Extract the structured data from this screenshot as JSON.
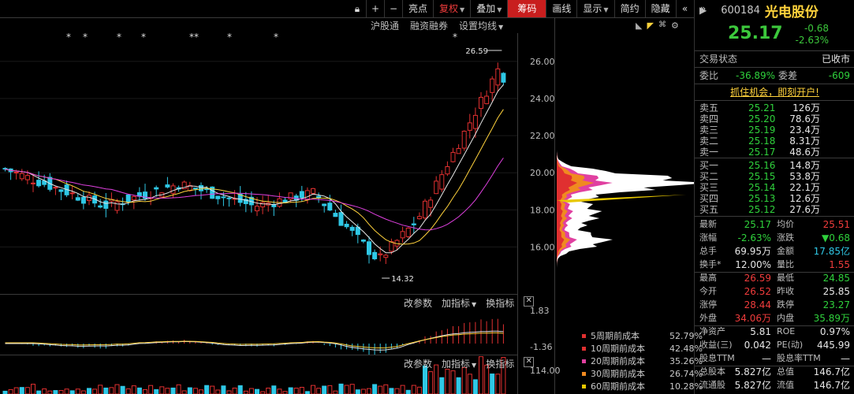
{
  "toolbar": {
    "icons": [
      "lock-icon",
      "plus-icon",
      "minus-icon"
    ],
    "buttons": [
      {
        "label": "亮点",
        "dropdown": false,
        "active": false
      },
      {
        "label": "复权",
        "dropdown": true,
        "active": false
      },
      {
        "label": "叠加",
        "dropdown": true,
        "active": false
      },
      {
        "label": "筹码",
        "dropdown": false,
        "active": true
      },
      {
        "label": "画线",
        "dropdown": false,
        "active": false
      },
      {
        "label": "显示",
        "dropdown": true,
        "active": false
      },
      {
        "label": "简约",
        "dropdown": false,
        "active": false
      },
      {
        "label": "隐藏",
        "dropdown": false,
        "active": false
      }
    ],
    "nav": [
      "«",
      "»"
    ]
  },
  "subbar": {
    "items": [
      "沪股通",
      "融资融券",
      "设置均线"
    ]
  },
  "chart": {
    "price_ticks": [
      "26.00",
      "24.00",
      "22.00",
      "20.00",
      "18.00",
      "16.00"
    ],
    "high_label": "26.59",
    "low_label": "14.32",
    "stars": [
      "*",
      "*",
      "*",
      "*",
      "*",
      "**",
      "*",
      "*",
      "*"
    ],
    "macd": {
      "top": "1.83",
      "bottom": "-1.36"
    },
    "volume": {
      "top": "114.00"
    },
    "indicator_bar": [
      "改参数",
      "加指标",
      "换指标"
    ]
  },
  "cost_legend": [
    {
      "name": "5周期前成本",
      "value": "52.79%",
      "color": "#e03030"
    },
    {
      "name": "10周期前成本",
      "value": "42.48%",
      "color": "#e03030"
    },
    {
      "name": "20周期前成本",
      "value": "35.26%",
      "color": "#e040a0"
    },
    {
      "name": "30周期前成本",
      "value": "26.74%",
      "color": "#f08a20"
    },
    {
      "name": "60周期前成本",
      "value": "10.28%",
      "color": "#e8c800"
    }
  ],
  "quote": {
    "code": "600184",
    "name": "光电股份",
    "price": "25.17",
    "change": "-0.68",
    "change_pct": "-2.63%",
    "status_label": "交易状态",
    "status": "已收市",
    "weibi_label": "委比",
    "weibi": "-36.89%",
    "weicha_label": "委差",
    "weicha": "-609",
    "promo": "抓住机会，即刻开户!",
    "asks": [
      {
        "label": "卖五",
        "price": "25.21",
        "vol": "126万"
      },
      {
        "label": "卖四",
        "price": "25.20",
        "vol": "78.6万"
      },
      {
        "label": "卖三",
        "price": "25.19",
        "vol": "23.4万"
      },
      {
        "label": "卖二",
        "price": "25.18",
        "vol": "8.31万"
      },
      {
        "label": "卖一",
        "price": "25.17",
        "vol": "48.6万"
      }
    ],
    "bids": [
      {
        "label": "买一",
        "price": "25.16",
        "vol": "14.8万"
      },
      {
        "label": "买二",
        "price": "25.15",
        "vol": "53.8万"
      },
      {
        "label": "买三",
        "price": "25.14",
        "vol": "22.1万"
      },
      {
        "label": "买四",
        "price": "25.13",
        "vol": "12.6万"
      },
      {
        "label": "买五",
        "price": "25.12",
        "vol": "27.6万"
      }
    ],
    "stats": [
      {
        "l1": "最新",
        "v1": "25.17",
        "c1": "green",
        "l2": "均价",
        "v2": "25.51",
        "c2": "red"
      },
      {
        "l1": "涨幅",
        "v1": "-2.63%",
        "c1": "green",
        "l2": "涨跌",
        "v2": "▼0.68",
        "c2": "green"
      },
      {
        "l1": "总手",
        "v1": "69.95万",
        "c1": "white",
        "l2": "金额",
        "v2": "17.85亿",
        "c2": "cyan"
      },
      {
        "l1": "换手*",
        "v1": "12.00%",
        "c1": "white",
        "l2": "量比",
        "v2": "1.55",
        "c2": "red"
      },
      {
        "l1": "最高",
        "v1": "26.59",
        "c1": "red",
        "l2": "最低",
        "v2": "24.85",
        "c2": "green"
      },
      {
        "l1": "今开",
        "v1": "26.52",
        "c1": "red",
        "l2": "昨收",
        "v2": "25.85",
        "c2": "white"
      },
      {
        "l1": "涨停",
        "v1": "28.44",
        "c1": "red",
        "l2": "跌停",
        "v2": "23.27",
        "c2": "green"
      },
      {
        "l1": "外盘",
        "v1": "34.06万",
        "c1": "red",
        "l2": "内盘",
        "v2": "35.89万",
        "c2": "green"
      },
      {
        "l1": "净资产",
        "v1": "5.81",
        "c1": "white",
        "l2": "ROE",
        "v2": "0.97%",
        "c2": "white"
      },
      {
        "l1": "收益(三)",
        "v1": "0.042",
        "c1": "white",
        "l2": "PE(动)",
        "v2": "445.99",
        "c2": "white"
      },
      {
        "l1": "股息TTM",
        "v1": "—",
        "c1": "white",
        "l2": "股息率TTM",
        "v2": "—",
        "c2": "white"
      },
      {
        "l1": "总股本",
        "v1": "5.827亿",
        "c1": "white",
        "l2": "总值",
        "v2": "146.7亿",
        "c2": "white"
      },
      {
        "l1": "流通股",
        "v1": "5.827亿",
        "c1": "white",
        "l2": "流值",
        "v2": "146.7亿",
        "c2": "white"
      }
    ]
  }
}
